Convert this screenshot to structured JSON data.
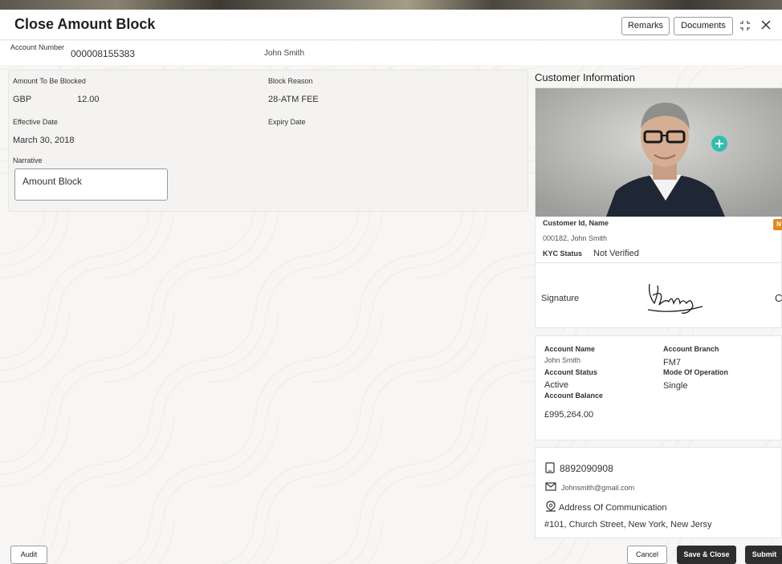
{
  "header": {
    "title": "Close Amount Block",
    "remarks_label": "Remarks",
    "documents_label": "Documents"
  },
  "account": {
    "label": "Account Number",
    "number": "000008155383",
    "name": "John Smith"
  },
  "form": {
    "amount_label": "Amount To Be Blocked",
    "currency": "GBP",
    "amount": "12.00",
    "block_reason_label": "Block Reason",
    "block_reason": "28-ATM FEE",
    "effective_date_label": "Effective Date",
    "effective_date": "March 30, 2018",
    "expiry_date_label": "Expiry Date",
    "narrative_label": "Narrative",
    "narrative": "Amount Block"
  },
  "customer": {
    "section_title": "Customer Information",
    "id_name_label": "Customer Id, Name",
    "id_name": "000182, John Smith",
    "badge": "N",
    "kyc_label": "KYC Status",
    "kyc_value": "Not Verified"
  },
  "signature": {
    "label": "Signature",
    "trailing_char": "C"
  },
  "account_info": {
    "name_label": "Account Name",
    "name": "John Smith",
    "branch_label": "Account Branch",
    "branch": "FM7",
    "status_label": "Account Status",
    "status": "Active",
    "mode_label": "Mode Of Operation",
    "mode": "Single",
    "balance_label": "Account Balance",
    "balance": "£995,264.00"
  },
  "contact": {
    "phone": "8892090908",
    "email": "Johnsmith@gmail.com",
    "address_label": "Address Of Communication",
    "address": "#101, Church Street, New York, New Jersy"
  },
  "footer": {
    "audit_label": "Audit",
    "cancel_label": "Cancel",
    "save_close_label": "Save & Close",
    "submit_label": "Submit"
  },
  "colors": {
    "primary_button": "#2e2e2e",
    "badge": "#e08a1e",
    "accent_teal": "#2fbfb1"
  },
  "icons": {
    "resize": "expand-icon",
    "close": "close-icon",
    "phone": "phone-icon",
    "email": "mail-icon",
    "address": "location-pin-icon"
  }
}
